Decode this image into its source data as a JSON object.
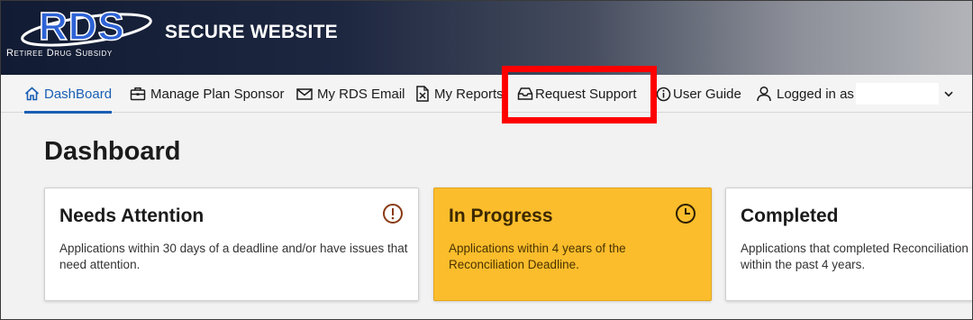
{
  "header": {
    "logo_text": "RDS",
    "logo_subtitle": "Retiree Drug Subsidy",
    "site_title": "SECURE WEBSITE"
  },
  "nav": {
    "items": [
      {
        "label": "DashBoard",
        "icon": "home-icon"
      },
      {
        "label": "Manage Plan Sponsor",
        "icon": "briefcase-icon"
      },
      {
        "label": "My RDS Email",
        "icon": "envelope-icon"
      },
      {
        "label": "My Reports",
        "icon": "excel-file-icon"
      },
      {
        "label": "Request Support",
        "icon": "inbox-icon"
      },
      {
        "label": "User Guide",
        "icon": "info-circle-icon"
      },
      {
        "label": "Logged in as",
        "icon": "user-icon"
      }
    ],
    "active_index": 0
  },
  "main": {
    "page_title": "Dashboard",
    "cards": [
      {
        "title": "Needs Attention",
        "description": "Applications within 30 days of a deadline and/or have issues that need attention.",
        "icon": "exclamation-circle-icon"
      },
      {
        "title": "In Progress",
        "description": "Applications within 4 years of the Reconciliation Deadline.",
        "icon": "clock-icon"
      },
      {
        "title": "Completed",
        "description": "Applications that completed Reconciliation within the past 4 years.",
        "icon": "check-circle-icon"
      }
    ]
  },
  "colors": {
    "accent": "#1a5fb4",
    "highlight": "#ff0000",
    "progress_card": "#fbbd2c",
    "attention_icon": "#8a3a12"
  }
}
